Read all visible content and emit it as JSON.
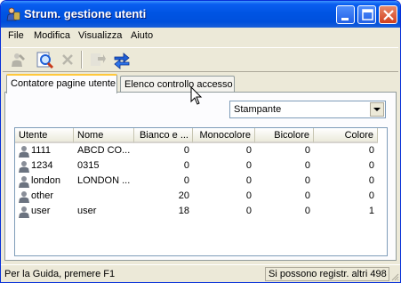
{
  "window": {
    "title": "Strum. gestione utenti"
  },
  "menu": [
    "File",
    "Modifica",
    "Visualizza",
    "Aiuto"
  ],
  "toolbar": {
    "buttons": [
      {
        "icon": "user-tool-icon",
        "enabled": false
      },
      {
        "icon": "search-icon",
        "enabled": true
      },
      {
        "icon": "delete-icon",
        "enabled": false
      },
      {
        "icon": "export-icon",
        "enabled": false
      },
      {
        "icon": "refresh-icon",
        "enabled": true
      }
    ]
  },
  "tabs": [
    {
      "label": "Contatore pagine utente",
      "active": true
    },
    {
      "label": "Elenco controllo accesso",
      "active": false
    }
  ],
  "device_select": {
    "value": "Stampante"
  },
  "table": {
    "columns": [
      "Utente",
      "Nome",
      "Bianco e ...",
      "Monocolore",
      "Bicolore",
      "Colore"
    ],
    "rows": [
      {
        "utente": "1111",
        "nome": "ABCD CO...",
        "bianco": "0",
        "mono": "0",
        "bicolore": "0",
        "colore": "0"
      },
      {
        "utente": "1234",
        "nome": "0315",
        "bianco": "0",
        "mono": "0",
        "bicolore": "0",
        "colore": "0"
      },
      {
        "utente": "london",
        "nome": "LONDON ...",
        "bianco": "0",
        "mono": "0",
        "bicolore": "0",
        "colore": "0"
      },
      {
        "utente": "other",
        "nome": "",
        "bianco": "20",
        "mono": "0",
        "bicolore": "0",
        "colore": "0"
      },
      {
        "utente": "user",
        "nome": "user",
        "bianco": "18",
        "mono": "0",
        "bicolore": "0",
        "colore": "1"
      }
    ]
  },
  "status": {
    "left": "Per la Guida, premere F1",
    "right": "Si possono registr. altri 498"
  },
  "colors": {
    "titlebar": "#0054e3",
    "window_bg": "#ece9d8",
    "icon_blue": "#1f5fd6"
  }
}
